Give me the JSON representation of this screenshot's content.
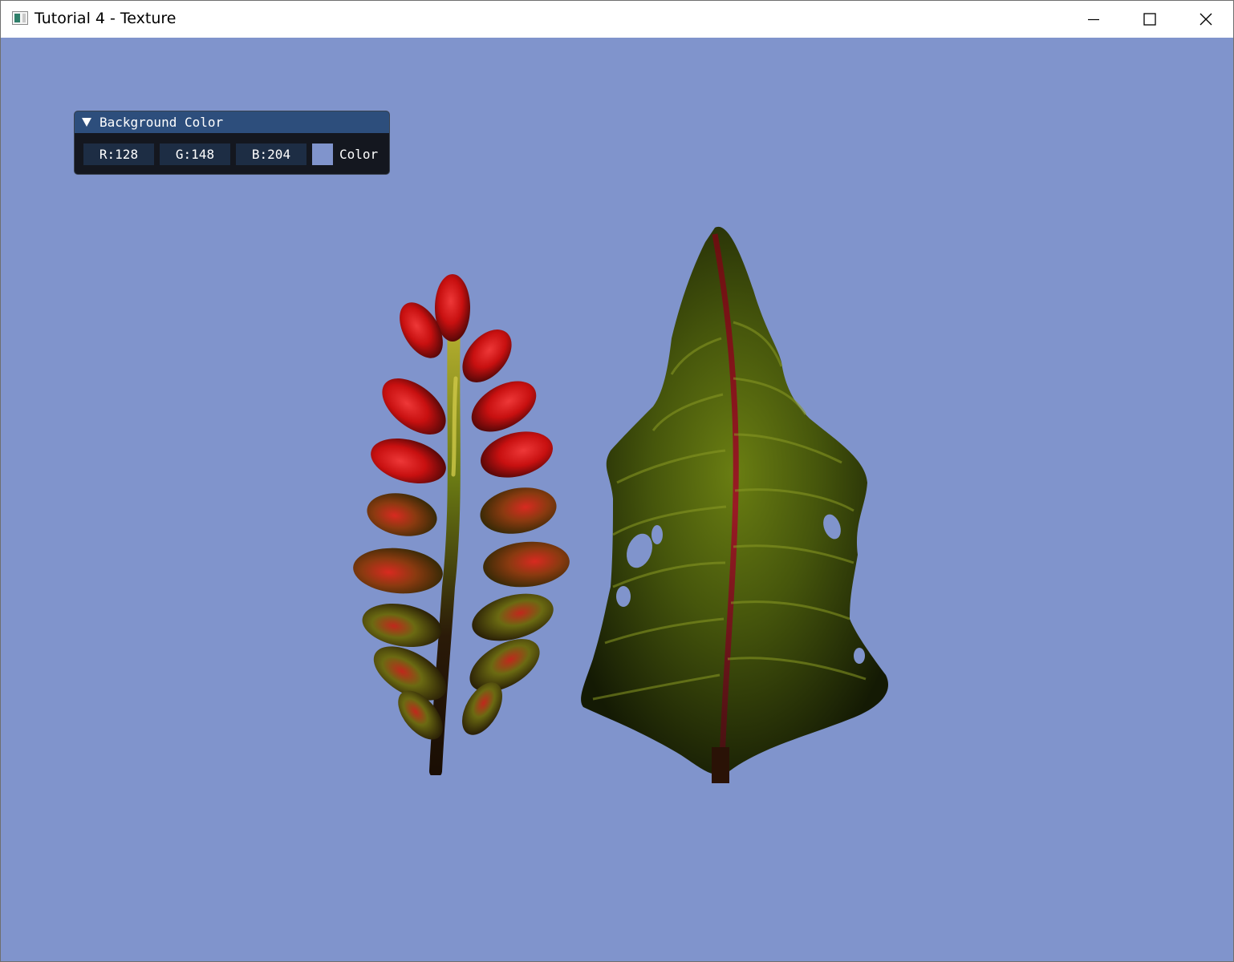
{
  "window": {
    "title": "Tutorial 4 - Texture",
    "icon": "app-window-icon",
    "controls": {
      "minimize": "minimize-icon",
      "maximize": "maximize-icon",
      "close": "close-icon"
    }
  },
  "background": {
    "color_hex": "#8094cc"
  },
  "imgui_panel": {
    "title": "Background Color",
    "collapse_icon": "triangle-down-icon",
    "r_field": "R:128",
    "g_field": "G:148",
    "b_field": "B:204",
    "swatch_color": "#8094cc",
    "color_label": "Color",
    "colors": {
      "panel_bg": "#14171f",
      "header_bg": "#2d4e7c",
      "field_bg": "#1d2d44"
    }
  },
  "scene": {
    "textured_quads": [
      {
        "name": "red-berry-plant-texture",
        "colors": [
          "#d01818",
          "#6b7a10",
          "#2a1a08"
        ]
      },
      {
        "name": "green-leaf-texture",
        "colors": [
          "#4a5e10",
          "#1e2806",
          "#8a1820"
        ]
      }
    ]
  }
}
